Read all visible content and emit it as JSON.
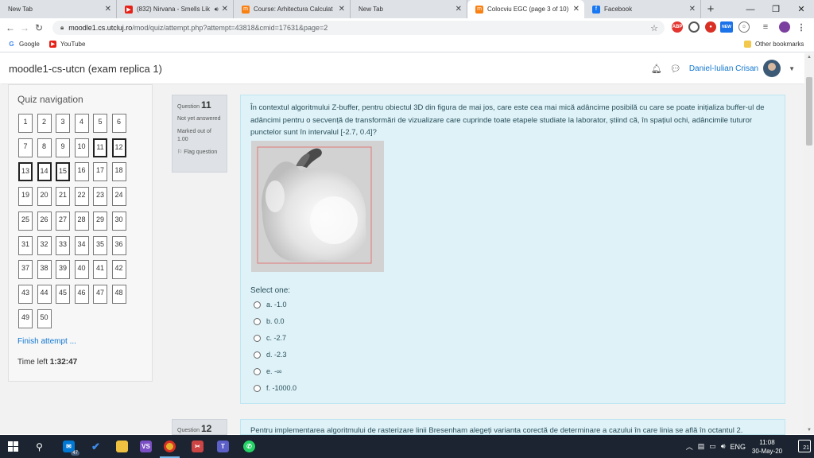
{
  "browser": {
    "tabs": [
      {
        "title": "New Tab",
        "icon": "none",
        "active": false
      },
      {
        "title": "(832) Nirvana - Smells Lik",
        "icon": "youtube-icon",
        "active": false,
        "audio": true
      },
      {
        "title": "Course: Arhitectura Calculat",
        "icon": "moodle-icon",
        "active": false
      },
      {
        "title": "New Tab",
        "icon": "none",
        "active": false
      },
      {
        "title": "Colocviu EGC (page 3 of 10)",
        "icon": "moodle-icon",
        "active": true
      },
      {
        "title": "Facebook",
        "icon": "facebook-icon",
        "active": false
      }
    ],
    "new_tab": "+",
    "url_host": "moodle1.cs.utcluj.ro",
    "url_path": "/mod/quiz/attempt.php?attempt=43818&cmid=17631&page=2",
    "bookmarks": [
      {
        "label": "Google",
        "icon": "google-icon"
      },
      {
        "label": "YouTube",
        "icon": "youtube-icon"
      }
    ],
    "other_bookmarks": "Other bookmarks",
    "ext_new_badge": "NEW"
  },
  "header": {
    "site_name": "moodle1-cs-utcn (exam replica 1)",
    "user_name": "Daniel-Iulian Crisan"
  },
  "quiz_nav": {
    "title": "Quiz navigation",
    "numbers": [
      "1",
      "2",
      "3",
      "4",
      "5",
      "6",
      "7",
      "8",
      "9",
      "10",
      "11",
      "12",
      "13",
      "14",
      "15",
      "16",
      "17",
      "18",
      "19",
      "20",
      "21",
      "22",
      "23",
      "24",
      "25",
      "26",
      "27",
      "28",
      "29",
      "30",
      "31",
      "32",
      "33",
      "34",
      "35",
      "36",
      "37",
      "38",
      "39",
      "40",
      "41",
      "42",
      "43",
      "44",
      "45",
      "46",
      "47",
      "48",
      "49",
      "50"
    ],
    "current_page": [
      "11",
      "12",
      "13",
      "14",
      "15"
    ],
    "finish": "Finish attempt ...",
    "time_left_label": "Time left",
    "time_left_value": "1:32:47"
  },
  "question": {
    "label": "Question",
    "number": "11",
    "status": "Not yet answered",
    "marked": "Marked out of 1.00",
    "flag": "Flag question",
    "text": "În contextul algoritmului Z-buffer, pentru obiectul 3D din figura de mai jos, care este cea mai mică adâncime posibilă cu care se poate inițializa buffer-ul de adâncimi pentru o secvență de transformări de vizualizare care cuprinde toate etapele studiate la laborator, știind că, în spațiul ochi, adâncimile  tuturor punctelor sunt în intervalul [-2.7, 0.4]?",
    "prompt": "Select one:",
    "options": [
      "a. -1.0",
      "b. 0.0",
      "c. -2.7",
      "d. -2.3",
      "e. -∞",
      "f. -1000.0"
    ]
  },
  "next_question": {
    "label": "Question",
    "number": "12",
    "text": "Pentru implementarea algoritmului de rasterizare linii Bresenham alegeți varianta corectă de determinare a cazului în care linia se află în octantul 2."
  },
  "taskbar": {
    "mail_badge": "47",
    "tray_lang": "ENG",
    "time": "11:08",
    "date": "30-May-20",
    "notif_count": "21"
  },
  "colors": {
    "link": "#1177d1",
    "question_bg": "#def2f8",
    "info_bg": "#dee2e6",
    "taskbar": "#1b2430"
  }
}
